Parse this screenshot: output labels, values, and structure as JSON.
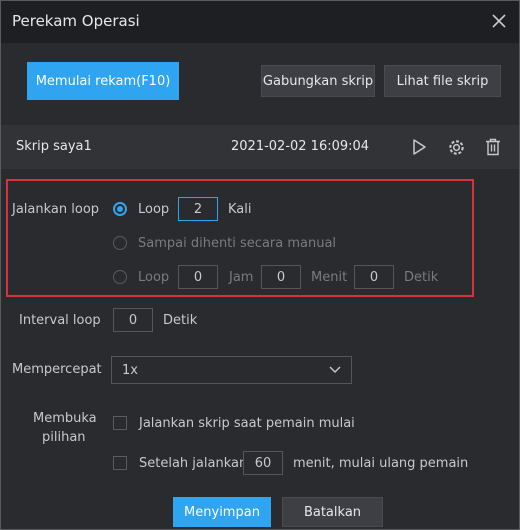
{
  "window": {
    "title": "Perekam Operasi"
  },
  "toolbar": {
    "record_label": "Memulai rekam(F10)",
    "merge_label": "Gabungkan skrip",
    "view_label": "Lihat file skrip"
  },
  "script": {
    "name": "Skrip saya1",
    "timestamp": "2021-02-02 16:09:04"
  },
  "loop": {
    "label": "Jalankan loop",
    "option_count": {
      "label": "Loop",
      "value": "2",
      "unit": "Kali"
    },
    "option_manual": {
      "label": "Sampai dihenti secara manual"
    },
    "option_duration": {
      "label": "Loop",
      "hours": "0",
      "hours_unit": "Jam",
      "minutes": "0",
      "minutes_unit": "Menit",
      "seconds": "0",
      "seconds_unit": "Detik"
    }
  },
  "interval": {
    "label": "Interval loop",
    "value": "0",
    "unit": "Detik"
  },
  "speed": {
    "label": "Mempercepat",
    "value": "1x"
  },
  "options": {
    "label_line1": "Membuka",
    "label_line2": "pilihan",
    "run_on_start": "Jalankan skrip saat pemain mulai",
    "restart_prefix": "Setelah jalankan",
    "restart_value": "60",
    "restart_suffix": "menit, mulai ulang pemain"
  },
  "footer": {
    "save_label": "Menyimpan",
    "cancel_label": "Batalkan"
  },
  "colors": {
    "accent": "#2fa4f0",
    "highlight": "#d6333a",
    "background": "#2a2b2f"
  }
}
